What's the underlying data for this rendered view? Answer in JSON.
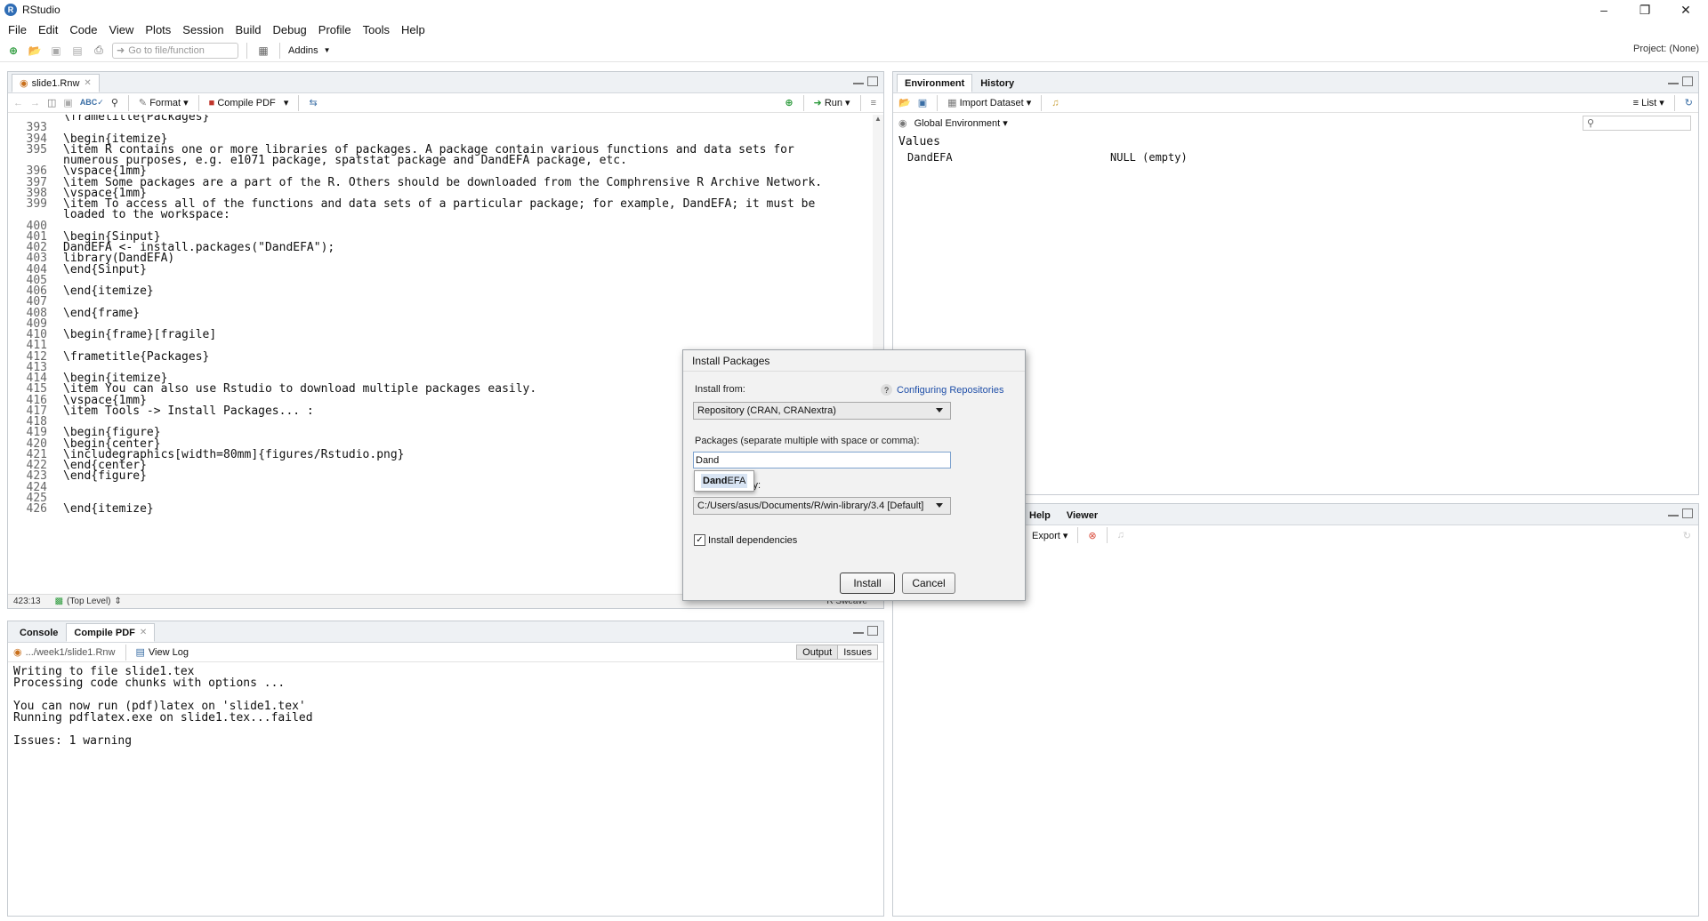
{
  "app": {
    "title": "RStudio"
  },
  "menu": [
    "File",
    "Edit",
    "Code",
    "View",
    "Plots",
    "Session",
    "Build",
    "Debug",
    "Profile",
    "Tools",
    "Help"
  ],
  "toolbar": {
    "goto_placeholder": "Go to file/function",
    "addins": "Addins",
    "project": "Project: (None)"
  },
  "editor": {
    "tab": "slide1.Rnw",
    "format": "Format",
    "compile": "Compile PDF",
    "run": "Run",
    "position": "423:13",
    "scope": "(Top Level)",
    "mode": "R Sweave",
    "lines": [
      {
        "n": "",
        "t": "\\frametitle{Packages}"
      },
      {
        "n": "393",
        "t": ""
      },
      {
        "n": "394",
        "t": "\\begin{itemize}"
      },
      {
        "n": "395",
        "t": "\\item R contains one or more libraries of packages. A package contain various functions and data sets for"
      },
      {
        "n": "",
        "t": "numerous purposes, e.g. e1071 package, spatstat package and DandEFA package, etc."
      },
      {
        "n": "396",
        "t": "\\vspace{1mm}"
      },
      {
        "n": "397",
        "t": "\\item Some packages are a part of the R. Others should be downloaded from the Comphrensive R Archive Network."
      },
      {
        "n": "398",
        "t": "\\vspace{1mm}"
      },
      {
        "n": "399",
        "t": "\\item To access all of the functions and data sets of a particular package; for example, DandEFA; it must be"
      },
      {
        "n": "",
        "t": "loaded to the workspace:"
      },
      {
        "n": "400",
        "t": ""
      },
      {
        "n": "401",
        "t": "\\begin{Sinput}"
      },
      {
        "n": "402",
        "t": "DandEFA <- install.packages(\"DandEFA\");"
      },
      {
        "n": "403",
        "t": "library(DandEFA)"
      },
      {
        "n": "404",
        "t": "\\end{Sinput}"
      },
      {
        "n": "405",
        "t": ""
      },
      {
        "n": "406",
        "t": "\\end{itemize}"
      },
      {
        "n": "407",
        "t": ""
      },
      {
        "n": "408",
        "t": "\\end{frame}"
      },
      {
        "n": "409",
        "t": ""
      },
      {
        "n": "410",
        "t": "\\begin{frame}[fragile]"
      },
      {
        "n": "411",
        "t": ""
      },
      {
        "n": "412",
        "t": "\\frametitle{Packages}"
      },
      {
        "n": "413",
        "t": ""
      },
      {
        "n": "414",
        "t": "\\begin{itemize}"
      },
      {
        "n": "415",
        "t": "\\item You can also use Rstudio to download multiple packages easily."
      },
      {
        "n": "416",
        "t": "\\vspace{1mm}"
      },
      {
        "n": "417",
        "t": "\\item Tools -> Install Packages... :"
      },
      {
        "n": "418",
        "t": ""
      },
      {
        "n": "419",
        "t": "\\begin{figure}"
      },
      {
        "n": "420",
        "t": "\\begin{center}"
      },
      {
        "n": "421",
        "t": "\\includegraphics[width=80mm]{figures/Rstudio.png}"
      },
      {
        "n": "422",
        "t": "\\end{center}"
      },
      {
        "n": "423",
        "t": "\\end{figure}"
      },
      {
        "n": "424",
        "t": ""
      },
      {
        "n": "425",
        "t": ""
      },
      {
        "n": "426",
        "t": "\\end{itemize}"
      }
    ]
  },
  "console": {
    "tabs": [
      "Console",
      "Compile PDF"
    ],
    "path": ".../week1/slide1.Rnw",
    "view_log": "View Log",
    "output_btn": "Output",
    "issues_btn": "Issues",
    "output": [
      "Writing to file slide1.tex",
      "Processing code chunks with options ...",
      "",
      "You can now run (pdf)latex on 'slide1.tex'",
      "Running pdflatex.exe on slide1.tex...failed",
      "",
      "Issues: 1 warning"
    ]
  },
  "environment": {
    "tabs": [
      "Environment",
      "History"
    ],
    "import": "Import Dataset",
    "list": "List",
    "scope": "Global Environment",
    "section": "Values",
    "rows": [
      {
        "name": "DandEFA",
        "value": "NULL (empty)"
      }
    ]
  },
  "files_pane": {
    "tabs": [
      "Help",
      "Viewer"
    ],
    "export": "Export"
  },
  "dialog": {
    "title": "Install Packages",
    "install_from_label": "Install from:",
    "help_link": "Configuring Repositories",
    "install_from_value": "Repository (CRAN, CRANextra)",
    "packages_label": "Packages (separate multiple with space or comma):",
    "packages_value": "Dand",
    "suggest_bold": "Dand",
    "suggest_rest": "EFA",
    "library_label_tail": "rary:",
    "library_value": "C:/Users/asus/Documents/R/win-library/3.4 [Default]",
    "deps_label": "Install dependencies",
    "install_btn": "Install",
    "cancel_btn": "Cancel"
  }
}
